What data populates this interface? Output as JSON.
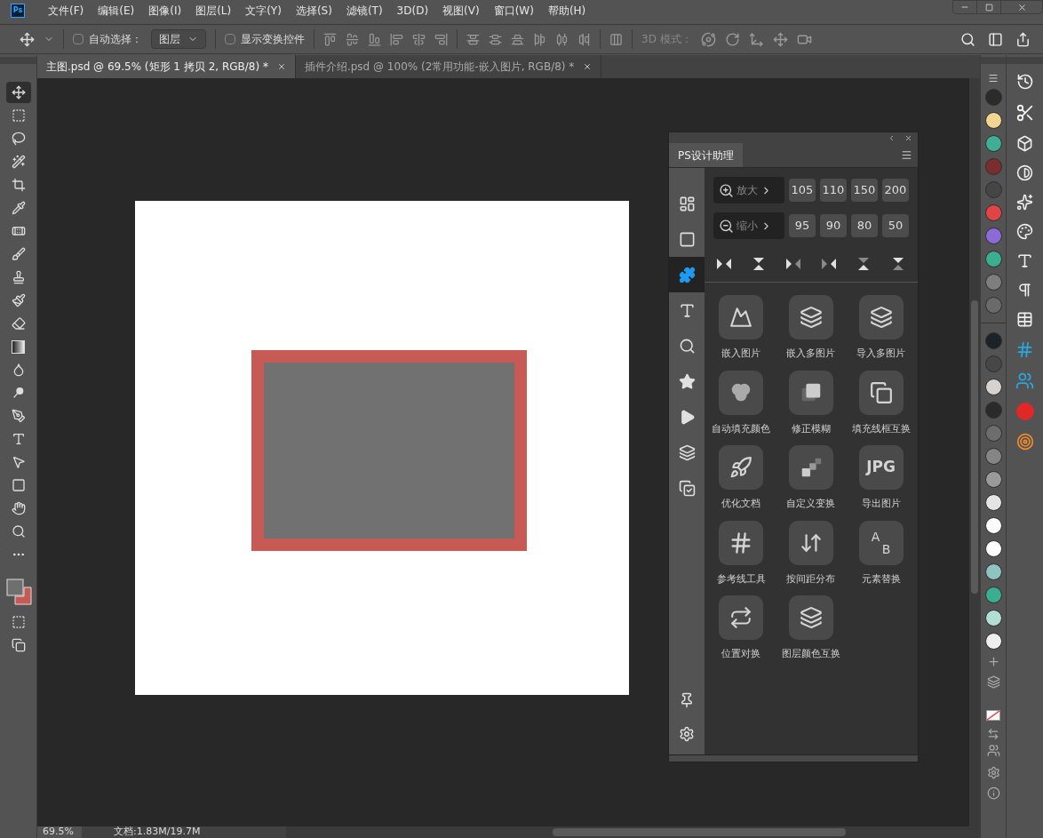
{
  "app_icon": "Ps",
  "menu": [
    "文件(F)",
    "编辑(E)",
    "图像(I)",
    "图层(L)",
    "文字(Y)",
    "选择(S)",
    "滤镜(T)",
    "3D(D)",
    "视图(V)",
    "窗口(W)",
    "帮助(H)"
  ],
  "options_bar": {
    "auto_select": {
      "label": "自动选择：",
      "checked": false
    },
    "auto_select_target": "图层",
    "show_transform": {
      "label": "显示变换控件",
      "checked": false
    },
    "mode_3d_label": "3D 模式："
  },
  "tabs": [
    {
      "label": "主图.psd @ 69.5% (矩形 1 拷贝 2, RGB/8) *",
      "selected": true
    },
    {
      "label": "插件介绍.psd @ 100% (2常用功能-嵌入图片, RGB/8) *",
      "selected": false
    }
  ],
  "tools": [
    {
      "kind": "move",
      "selected": true
    },
    {
      "kind": "marquee",
      "selected": false
    },
    {
      "kind": "lasso",
      "selected": false
    },
    {
      "kind": "quick-select",
      "selected": false
    },
    {
      "kind": "crop",
      "selected": false
    },
    {
      "kind": "eyedropper",
      "selected": false
    },
    {
      "kind": "healing",
      "selected": false
    },
    {
      "kind": "brush",
      "selected": false
    },
    {
      "kind": "stamp",
      "selected": false
    },
    {
      "kind": "history-brush",
      "selected": false
    },
    {
      "kind": "eraser",
      "selected": false
    },
    {
      "kind": "gradient",
      "selected": false
    },
    {
      "kind": "blur",
      "selected": false
    },
    {
      "kind": "dodge",
      "selected": false
    },
    {
      "kind": "pen",
      "selected": false
    },
    {
      "kind": "type",
      "selected": false
    },
    {
      "kind": "path-select",
      "selected": false
    },
    {
      "kind": "rectangle",
      "selected": false
    },
    {
      "kind": "hand",
      "selected": false
    },
    {
      "kind": "zoom",
      "selected": false
    },
    {
      "kind": "more",
      "selected": false
    }
  ],
  "color_chips": [
    {
      "kind": "foreground",
      "color": "#6f6f6f"
    },
    {
      "kind": "background",
      "color": "#c75a55"
    }
  ],
  "plugin_panel": {
    "title": "PS设计助理",
    "sidebar": [
      {
        "kind": "layout",
        "selected": false
      },
      {
        "kind": "shape",
        "selected": false
      },
      {
        "kind": "plugin",
        "selected": true
      },
      {
        "kind": "text",
        "selected": false
      },
      {
        "kind": "text-search",
        "selected": false
      },
      {
        "kind": "star",
        "selected": false
      },
      {
        "kind": "play",
        "selected": false
      },
      {
        "kind": "layers",
        "selected": false
      },
      {
        "kind": "check-copy",
        "selected": false
      }
    ],
    "zoom_in": {
      "label": "放大",
      "presets": [
        "105",
        "110",
        "150",
        "200"
      ]
    },
    "zoom_out": {
      "label": "缩小",
      "presets": [
        "95",
        "90",
        "80",
        "50"
      ]
    },
    "actions": [
      {
        "label": "嵌入图片",
        "kind": "image"
      },
      {
        "label": "嵌入多图片",
        "kind": "layers"
      },
      {
        "label": "导入多图片",
        "kind": "import"
      },
      {
        "label": "自动填充颜色",
        "kind": "circles"
      },
      {
        "label": "修正模糊",
        "kind": "square-shadow"
      },
      {
        "label": "填充线框互换",
        "kind": "copy"
      },
      {
        "label": "优化文档",
        "kind": "rocket"
      },
      {
        "label": "自定义变换",
        "kind": "blocks"
      },
      {
        "label": "导出图片",
        "kind": "badge",
        "badge": "JPG"
      },
      {
        "label": "参考线工具",
        "kind": "grid"
      },
      {
        "label": "按间距分布",
        "kind": "distribute"
      },
      {
        "label": "元素替换",
        "kind": "letters",
        "glyphs": [
          "A",
          "B"
        ]
      },
      {
        "label": "位置对换",
        "kind": "swap"
      },
      {
        "label": "图层颜色互换",
        "kind": "layer-swap"
      }
    ]
  },
  "swatches_top": [
    {
      "color": "#2b2b2b"
    },
    {
      "color": "#f2d58e"
    },
    {
      "color": "#3fae94"
    },
    {
      "color": "#7a2d2d"
    },
    {
      "color": "#454545"
    },
    {
      "color": "#e04444"
    },
    {
      "color": "#8c6ad8"
    },
    {
      "color": "#3aae8e"
    },
    {
      "color": "#7e7e7e"
    },
    {
      "color": "#6a6a6a"
    }
  ],
  "swatches_bottom": [
    {
      "color": "#1b2228"
    },
    {
      "color": "#474747"
    },
    {
      "color": "#d6d2cf"
    },
    {
      "color": "#2a2a2a"
    },
    {
      "color": "#6d6d6d"
    },
    {
      "color": "#858585"
    },
    {
      "color": "#9a9a9a"
    },
    {
      "color": "#e4e4e4"
    },
    {
      "color": "#ffffff"
    },
    {
      "color": "#fefefe"
    },
    {
      "color": "#8fc3c0"
    },
    {
      "color": "#3bae8f"
    },
    {
      "color": "#b2dfd3"
    },
    {
      "color": "#eeeeee"
    }
  ],
  "status_bar": {
    "zoom": "69.5%",
    "doc_info": "文档:1.83M/19.7M"
  }
}
